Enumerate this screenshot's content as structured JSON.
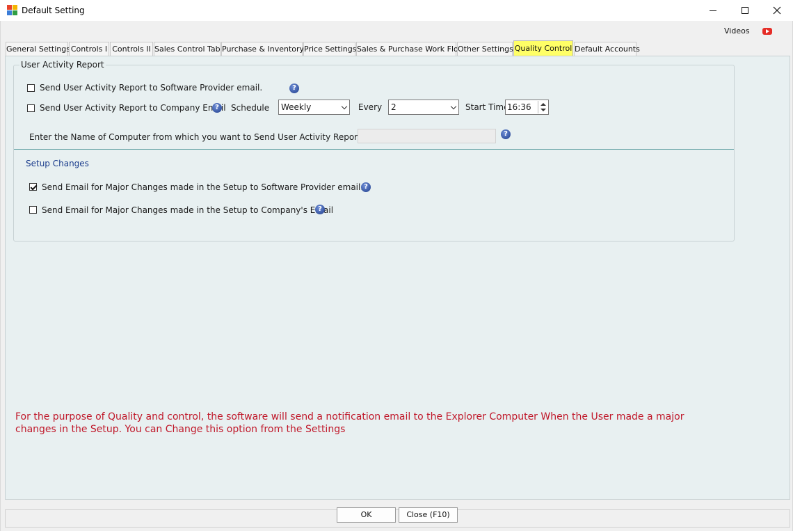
{
  "window": {
    "title": "Default Setting"
  },
  "header": {
    "videos_label": "Videos",
    "youtube_color": "#e52d27"
  },
  "tabs": [
    {
      "label": "General Settings",
      "active": false
    },
    {
      "label": "Controls I",
      "active": false
    },
    {
      "label": "Controls II",
      "active": false
    },
    {
      "label": "Sales Control Tab",
      "active": false
    },
    {
      "label": "Purchase & Inventory",
      "active": false
    },
    {
      "label": "Price Settings",
      "active": false
    },
    {
      "label": "Sales & Purchase Work Flow",
      "active": false
    },
    {
      "label": "Other Settings",
      "active": false
    },
    {
      "label": "Quality Control",
      "active": true
    },
    {
      "label": "Default Accounts",
      "active": false
    }
  ],
  "user_activity": {
    "group_title": "User Activity Report",
    "provider_email_label": "Send User Activity Report to Software Provider email.",
    "provider_email_checked": false,
    "company_email_label": "Send User Activity Report to Company Email",
    "company_email_checked": false,
    "schedule_label": "Schedule",
    "schedule_value": "Weekly",
    "every_label": "Every",
    "every_value": "2",
    "start_time_label": "Start Time",
    "start_time_value": "16:36",
    "computer_name_label": "Enter the Name of Computer from which you want to  Send User Activity Report",
    "computer_name_value": ""
  },
  "setup_changes": {
    "title": "Setup Changes",
    "provider_email_label": "Send Email for Major Changes made in the Setup to Software Provider email.",
    "provider_email_checked": true,
    "company_email_label": "Send Email for Major Changes made in the Setup to Company's Email",
    "company_email_checked": false
  },
  "notice": {
    "text": "For the purpose of Quality and control, the software will send a notification email to the Explorer Computer When the User made a major changes in the Setup. You can Change this option from the Settings",
    "color": "#c0182a"
  },
  "help_icon_glyph": "?",
  "buttons": {
    "ok_label": "OK",
    "close_label": "Close (F10)"
  },
  "colors": {
    "active_tab": "#ffff66",
    "tab_page_background": "#e8f0f1",
    "divider": "#5d9ea0",
    "section_title": "#1a3c8c"
  }
}
